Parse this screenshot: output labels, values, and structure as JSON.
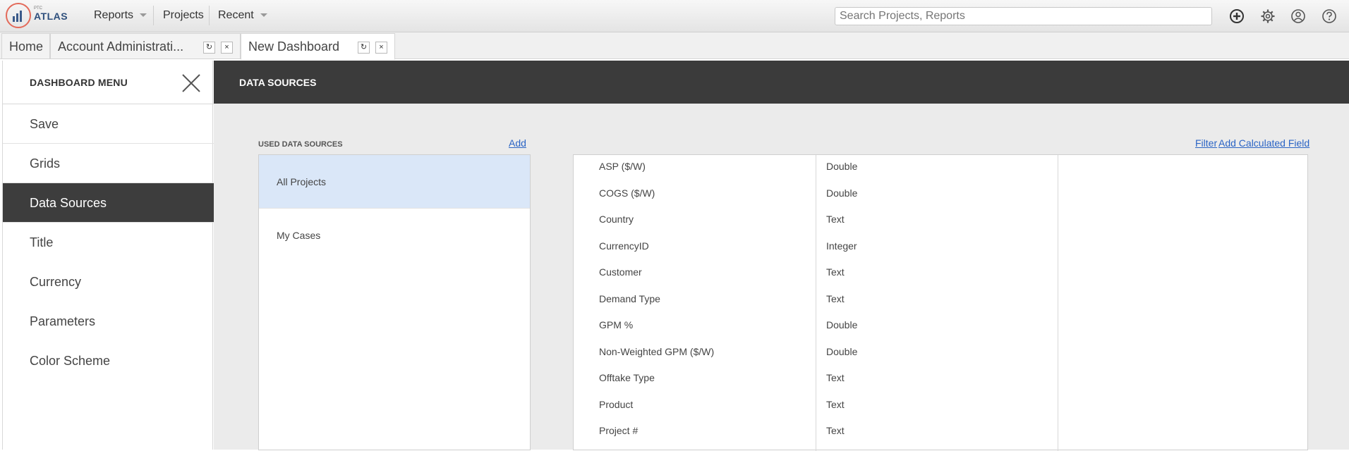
{
  "app": {
    "logo_small": "PTC",
    "logo_word": "ATLAS"
  },
  "nav": {
    "reports": "Reports",
    "projects": "Projects",
    "recent": "Recent"
  },
  "search": {
    "placeholder": "Search Projects, Reports"
  },
  "top_icons": [
    "add-circle-icon",
    "gear-icon",
    "user-icon",
    "help-icon"
  ],
  "tabs": [
    {
      "label": "Home"
    },
    {
      "label": "Account Administrati..."
    },
    {
      "label": "New Dashboard"
    }
  ],
  "tab_buttons": {
    "refresh": "↻",
    "close": "×"
  },
  "sidebar": {
    "title": "DASHBOARD MENU",
    "items": [
      {
        "label": "Save"
      },
      {
        "label": "Grids"
      },
      {
        "label": "Data Sources"
      },
      {
        "label": "Title"
      },
      {
        "label": "Currency"
      },
      {
        "label": "Parameters"
      },
      {
        "label": "Color Scheme"
      }
    ],
    "active_item": "Data Sources"
  },
  "main": {
    "title": "DATA SOURCES",
    "used_label": "USED DATA SOURCES",
    "add_link": "Add",
    "filter_link": "Filter",
    "add_calc_link": "Add Calculated Field",
    "data_sources": [
      {
        "label": "All Projects"
      },
      {
        "label": "My Cases"
      }
    ],
    "selected_source": "All Projects",
    "fields": [
      {
        "name": "ASP ($/W)",
        "type": "Double"
      },
      {
        "name": "COGS ($/W)",
        "type": "Double"
      },
      {
        "name": "Country",
        "type": "Text"
      },
      {
        "name": "CurrencyID",
        "type": "Integer"
      },
      {
        "name": "Customer",
        "type": "Text"
      },
      {
        "name": "Demand Type",
        "type": "Text"
      },
      {
        "name": "GPM %",
        "type": "Double"
      },
      {
        "name": "Non-Weighted GPM ($/W)",
        "type": "Double"
      },
      {
        "name": "Offtake Type",
        "type": "Text"
      },
      {
        "name": "Product",
        "type": "Text"
      },
      {
        "name": "Project #",
        "type": "Text"
      }
    ]
  },
  "colors": {
    "active_dark": "#3d3d3d",
    "header_dark": "#3b3b3b",
    "selected_blue": "#dae7f8",
    "link": "#2a64c5",
    "logo_ring": "#e36a5a",
    "logo_text": "#2e4f7c"
  }
}
